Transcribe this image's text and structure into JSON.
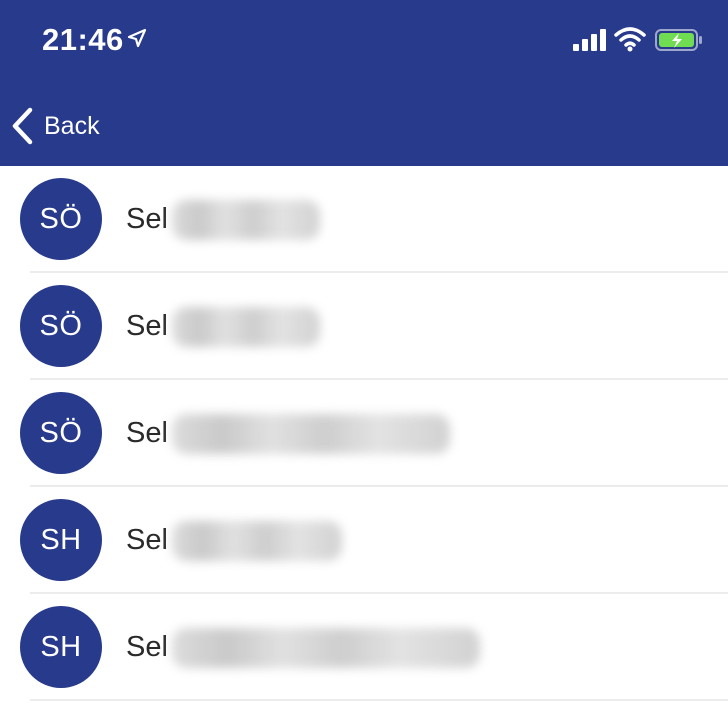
{
  "status_bar": {
    "time": "21:46",
    "icons": [
      "location-arrow-icon",
      "signal-bars-icon",
      "wifi-icon",
      "battery-charging-icon"
    ]
  },
  "nav": {
    "back_label": "Back",
    "back_icon": "chevron-left-icon"
  },
  "colors": {
    "primary": "#283a8c",
    "text": "#2a2a2a",
    "background": "#ffffff",
    "divider": "#ececec"
  },
  "contacts": [
    {
      "initials": "SÖ",
      "name_visible": "Sel"
    },
    {
      "initials": "SÖ",
      "name_visible": "Sel"
    },
    {
      "initials": "SÖ",
      "name_visible": "Sel"
    },
    {
      "initials": "SH",
      "name_visible": "Sel"
    },
    {
      "initials": "SH",
      "name_visible": "Sel"
    }
  ]
}
